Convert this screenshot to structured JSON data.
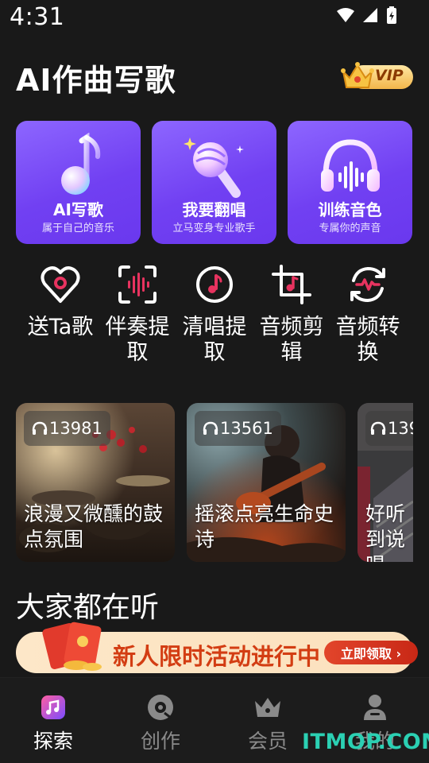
{
  "status_bar": {
    "time": "4:31"
  },
  "header": {
    "title": "AI作曲写歌",
    "vip_label": "VIP"
  },
  "feature_cards": [
    {
      "title": "AI写歌",
      "subtitle": "属于自己的音乐",
      "icon": "music-note-icon"
    },
    {
      "title": "我要翻唱",
      "subtitle": "立马变身专业歌手",
      "icon": "microphone-icon"
    },
    {
      "title": "训练音色",
      "subtitle": "专属你的声音",
      "icon": "headphones-icon"
    }
  ],
  "tools": [
    {
      "label": "送Ta歌",
      "icon": "heart-music-icon"
    },
    {
      "label": "伴奏提取",
      "icon": "waveform-scan-icon"
    },
    {
      "label": "清唱提取",
      "icon": "music-disc-icon"
    },
    {
      "label": "音频剪辑",
      "icon": "crop-music-icon"
    },
    {
      "label": "音频转换",
      "icon": "convert-wave-icon"
    }
  ],
  "playlists": [
    {
      "count": "13981",
      "title": "浪漫又微醺的鼓点氛围"
    },
    {
      "count": "13561",
      "title": "摇滚点亮生命史诗"
    },
    {
      "count": "139",
      "title": "好听到说唱"
    }
  ],
  "section": {
    "title": "大家都在听"
  },
  "promo": {
    "text": "新人限时活动进行中",
    "button": "立即领取 ›"
  },
  "bottom_nav": [
    {
      "label": "探索",
      "icon": "music-app-icon",
      "active": true
    },
    {
      "label": "创作",
      "icon": "disc-icon",
      "active": false
    },
    {
      "label": "会员",
      "icon": "crown-icon",
      "active": false
    },
    {
      "label": "我的",
      "icon": "user-icon",
      "active": false
    }
  ],
  "watermark": "ITMOP.COM",
  "colors": {
    "card_purple": "#7a4cf5",
    "accent_pink": "#e7335f",
    "promo_red": "#d33d13",
    "background": "#191919"
  }
}
